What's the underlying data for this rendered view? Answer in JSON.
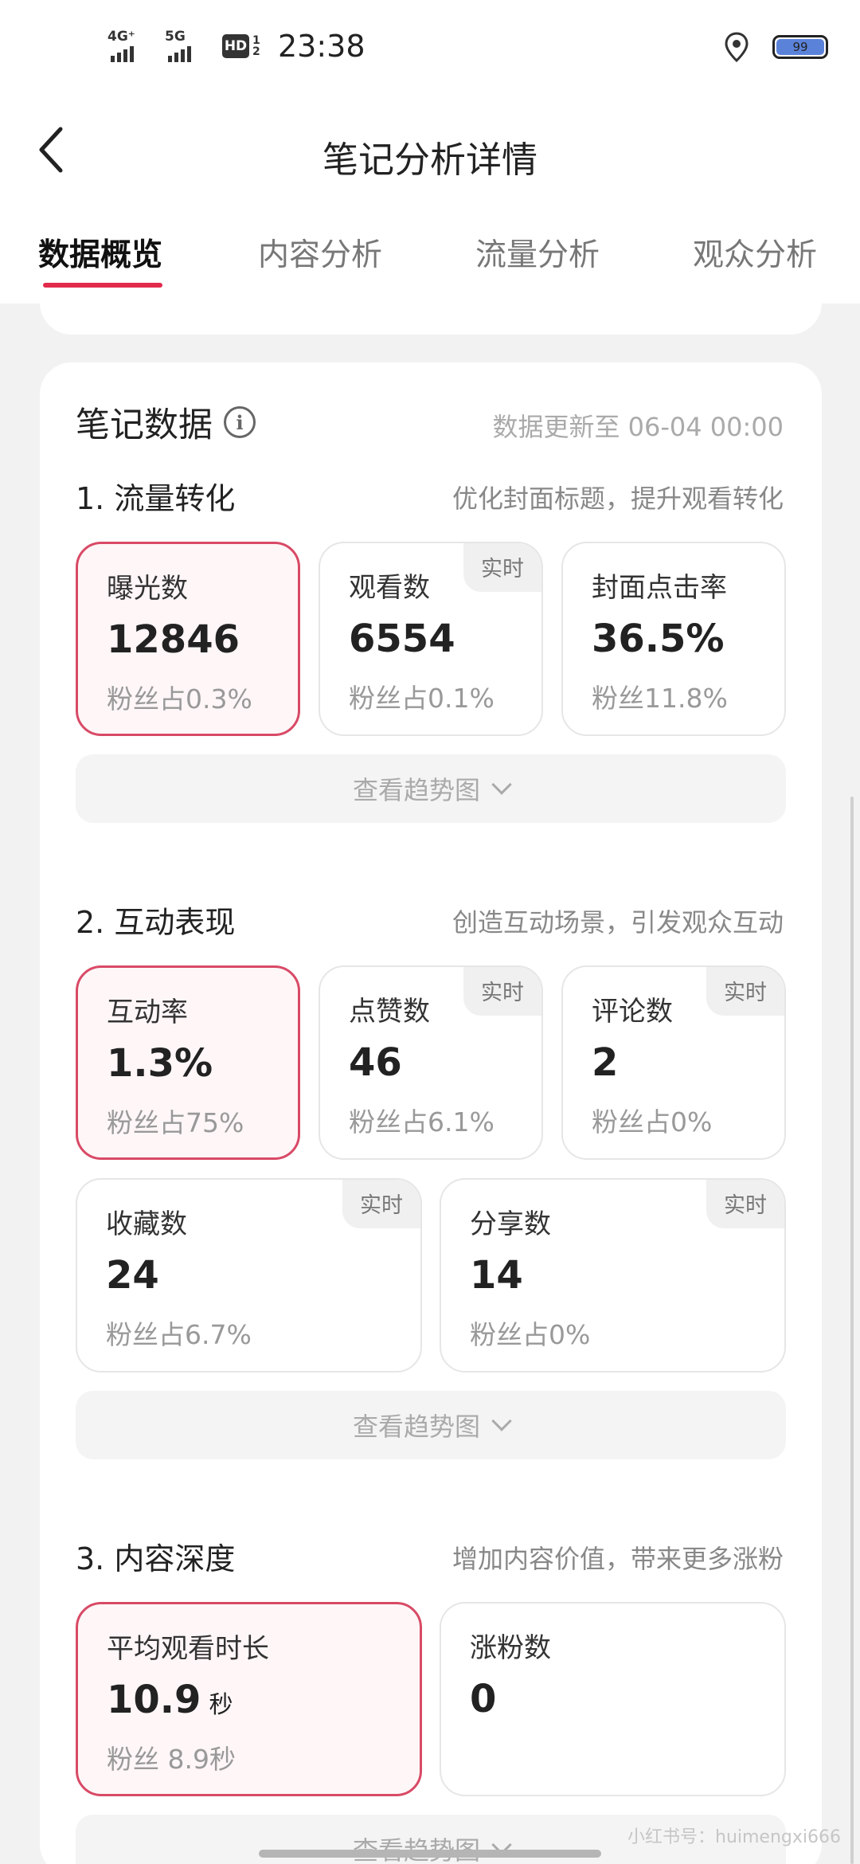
{
  "status_bar": {
    "net1": "4G⁺",
    "net2": "5G",
    "hd": "HD",
    "hd_sub": "1 2",
    "time": "23:38",
    "battery": "99"
  },
  "header": {
    "title": "笔记分析详情"
  },
  "tabs": [
    "数据概览",
    "内容分析",
    "流量分析",
    "观众分析"
  ],
  "card": {
    "title": "笔记数据",
    "updated": "数据更新至 06-04 00:00"
  },
  "sections": [
    {
      "title": "1. 流量转化",
      "hint": "优化封面标题，提升观看转化",
      "stats": [
        {
          "label": "曝光数",
          "value": "12846",
          "sub": "粉丝占0.3%"
        },
        {
          "label": "观看数",
          "value": "6554",
          "sub": "粉丝占0.1%",
          "badge": "实时"
        },
        {
          "label": "封面点击率",
          "value": "36.5%",
          "sub": "粉丝11.8%"
        }
      ],
      "trend": "查看趋势图"
    },
    {
      "title": "2. 互动表现",
      "hint": "创造互动场景，引发观众互动",
      "stats": [
        {
          "label": "互动率",
          "value": "1.3%",
          "sub": "粉丝占75%"
        },
        {
          "label": "点赞数",
          "value": "46",
          "sub": "粉丝占6.1%",
          "badge": "实时"
        },
        {
          "label": "评论数",
          "value": "2",
          "sub": "粉丝占0%",
          "badge": "实时"
        },
        {
          "label": "收藏数",
          "value": "24",
          "sub": "粉丝占6.7%",
          "badge": "实时"
        },
        {
          "label": "分享数",
          "value": "14",
          "sub": "粉丝占0%",
          "badge": "实时"
        }
      ],
      "trend": "查看趋势图"
    },
    {
      "title": "3. 内容深度",
      "hint": "增加内容价值，带来更多涨粉",
      "stats": [
        {
          "label": "平均观看时长",
          "value": "10.9",
          "unit": "秒",
          "sub": "粉丝 8.9秒"
        },
        {
          "label": "涨粉数",
          "value": "0"
        }
      ],
      "trend": "查看趋势图"
    }
  ],
  "watermark": "小红书号：huimengxi666"
}
